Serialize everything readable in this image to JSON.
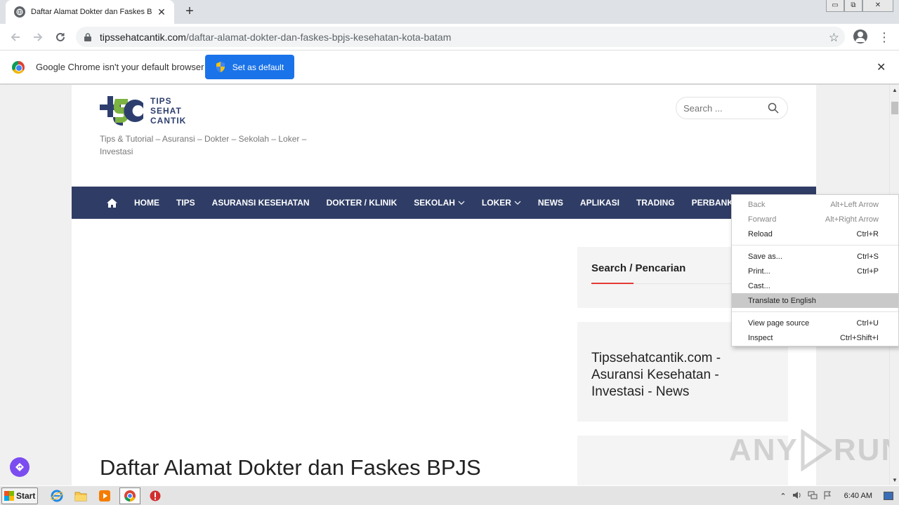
{
  "browser": {
    "tab_title": "Daftar Alamat Dokter dan Faskes BPJS",
    "tab_close": "✕",
    "new_tab": "+",
    "window_buttons": [
      "▭",
      "⧉",
      "✕"
    ],
    "url_host": "tipssehatcantik.com",
    "url_path": "/daftar-alamat-dokter-dan-faskes-bpjs-kesehatan-kota-batam"
  },
  "infobar": {
    "message": "Google Chrome isn't your default browser",
    "button_label": "Set as default",
    "close": "✕"
  },
  "site": {
    "logo_words": [
      "TIPS",
      "SEHAT",
      "CANTIK"
    ],
    "tagline": "Tips & Tutorial – Asuransi – Dokter – Sekolah – Loker – Investasi",
    "search_placeholder": "Search ...",
    "nav": [
      {
        "label": "HOME"
      },
      {
        "label": "TIPS"
      },
      {
        "label": "ASURANSI KESEHATAN"
      },
      {
        "label": "DOKTER / KLINIK"
      },
      {
        "label": "SEKOLAH",
        "dropdown": true
      },
      {
        "label": "LOKER",
        "dropdown": true
      },
      {
        "label": "NEWS"
      },
      {
        "label": "APLIKASI"
      },
      {
        "label": "TRADING"
      },
      {
        "label": "PERBANKAN"
      }
    ],
    "widget_search_title": "Search / Pencarian",
    "widget_promo_text": "Tipssehatcantik.com - Asuransi Kesehatan - Investasi - News",
    "article_title": "Daftar Alamat Dokter dan Faskes BPJS"
  },
  "context_menu": {
    "items": [
      {
        "label": "Back",
        "shortcut": "Alt+Left Arrow",
        "disabled": true
      },
      {
        "label": "Forward",
        "shortcut": "Alt+Right Arrow",
        "disabled": true
      },
      {
        "label": "Reload",
        "shortcut": "Ctrl+R"
      },
      {
        "label": "Save as...",
        "shortcut": "Ctrl+S"
      },
      {
        "label": "Print...",
        "shortcut": "Ctrl+P"
      },
      {
        "label": "Cast...",
        "shortcut": ""
      },
      {
        "label": "Translate to English",
        "shortcut": "",
        "highlighted": true
      },
      {
        "label": "View page source",
        "shortcut": "Ctrl+U"
      },
      {
        "label": "Inspect",
        "shortcut": "Ctrl+Shift+I"
      }
    ]
  },
  "watermark": {
    "left": "ANY",
    "right": "RUN"
  },
  "taskbar": {
    "start_label": "Start",
    "clock": "6:40 AM"
  },
  "colors": {
    "nav_bg": "#2f3d66",
    "set_default_btn": "#1a73e8",
    "widget_accent": "#e53935",
    "logo_green": "#7cb342",
    "logo_navy": "#2d3e6e"
  }
}
